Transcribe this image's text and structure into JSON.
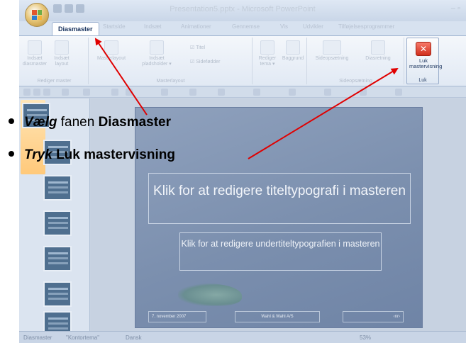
{
  "window": {
    "title": "Presentation5.pptx - Microsoft PowerPoint",
    "controls": "–  ▫"
  },
  "tabs": [
    "Diasmaster",
    "Startside",
    "Indsæt",
    "Animationer",
    "Gennemse",
    "Vis",
    "Udvikler",
    "Tilføjelsesprogrammer"
  ],
  "active_tab": "Diasmaster",
  "ribbon": {
    "groups": {
      "edit_master": "Rediger master",
      "master_layout": "Masterlayout",
      "edit_theme": "Rediger tema",
      "background": "Baggrund",
      "page_setup": "Sideopsætning",
      "close": "Luk"
    },
    "buttons": {
      "insert_slide_master": "Indsæt diasmaster",
      "insert_layout": "Indsæt layout",
      "master_layout": "Masterlayout",
      "insert_placeholder": "Indsæt pladsholder ▾",
      "edit_theme": "Rediger tema ▾",
      "background": "Baggrund",
      "page_setup": "Sideopsætning",
      "slide_orientation": "Diasretning",
      "close_master_view": "Luk mastervisning"
    },
    "checkboxes": {
      "title": "Titel",
      "footers": "Sidefødder"
    }
  },
  "slide": {
    "title_placeholder": "Klik for at redigere titeltypografi i masteren",
    "subtitle_placeholder": "Klik for at redigere undertiteltypografien i masteren",
    "footer_date": "7. november 2007",
    "footer_center": "Wahl & Wahl A/S",
    "footer_number": "‹nr›"
  },
  "statusbar": {
    "view": "Diasmaster",
    "theme": "\"Kontortema\"",
    "language": "Dansk",
    "zoom": "53%"
  },
  "instructions": {
    "step1": {
      "verb": "Vælg",
      "middle": " fanen ",
      "target": "Diasmaster"
    },
    "step2": {
      "verb": "Tryk",
      "target": " Luk mastervisning"
    }
  },
  "colors": {
    "arrow": "#e00000",
    "accent_tab": "#1b3560",
    "close_button": "#d12f1c"
  }
}
